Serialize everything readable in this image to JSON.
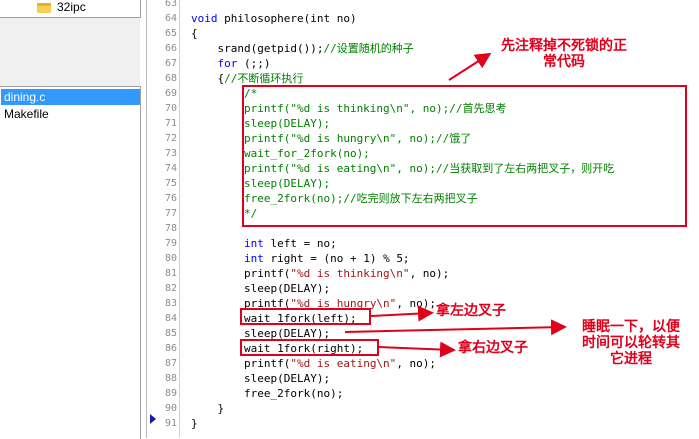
{
  "folder_panel": {
    "folder_label": "32ipc"
  },
  "file_list": {
    "items": [
      "dining.c",
      "Makefile"
    ]
  },
  "editor": {
    "lines": [
      {
        "n": "63",
        "segs": []
      },
      {
        "n": "64",
        "segs": [
          [
            "kw",
            "void"
          ],
          [
            "",
            "philosophere(int no)"
          ]
        ]
      },
      {
        "n": "65",
        "segs": [
          [
            "",
            "{"
          ]
        ]
      },
      {
        "n": "66",
        "segs": [
          [
            "",
            "    srand(getpid());"
          ],
          [
            "cmt",
            "//设置随机的种子"
          ]
        ]
      },
      {
        "n": "67",
        "segs": [
          [
            "",
            "    "
          ],
          [
            "kw",
            "for"
          ],
          [
            "",
            "(;;)"
          ]
        ]
      },
      {
        "n": "68",
        "segs": [
          [
            "",
            "    {"
          ],
          [
            "cmt",
            "//不断循环执行"
          ]
        ]
      },
      {
        "n": "69",
        "segs": [
          [
            "cmt",
            "        /*"
          ]
        ]
      },
      {
        "n": "70",
        "segs": [
          [
            "cmt",
            "        printf(\"%d is thinking\\n\", no);//首先思考"
          ]
        ]
      },
      {
        "n": "71",
        "segs": [
          [
            "cmt",
            "        sleep(DELAY);"
          ]
        ]
      },
      {
        "n": "72",
        "segs": [
          [
            "cmt",
            "        printf(\"%d is hungry\\n\", no);//饿了"
          ]
        ]
      },
      {
        "n": "73",
        "segs": [
          [
            "cmt",
            "        wait_for_2fork(no);"
          ]
        ]
      },
      {
        "n": "74",
        "segs": [
          [
            "cmt",
            "        printf(\"%d is eating\\n\", no);//当获取到了左右两把叉子，则开吃"
          ]
        ]
      },
      {
        "n": "75",
        "segs": [
          [
            "cmt",
            "        sleep(DELAY);"
          ]
        ]
      },
      {
        "n": "76",
        "segs": [
          [
            "cmt",
            "        free_2fork(no);//吃完则放下左右两把叉子"
          ]
        ]
      },
      {
        "n": "77",
        "segs": [
          [
            "cmt",
            "        */"
          ]
        ]
      },
      {
        "n": "78",
        "segs": []
      },
      {
        "n": "79",
        "segs": [
          [
            "",
            "        "
          ],
          [
            "kw",
            "int"
          ],
          [
            "",
            "left = no;"
          ]
        ]
      },
      {
        "n": "80",
        "segs": [
          [
            "",
            "        "
          ],
          [
            "kw",
            "int"
          ],
          [
            "",
            "right = (no + 1) % 5;"
          ]
        ]
      },
      {
        "n": "81",
        "segs": [
          [
            "",
            "        printf("
          ],
          [
            "str",
            "\"%d is thinking\\n\""
          ],
          [
            "",
            ", no);"
          ]
        ]
      },
      {
        "n": "82",
        "segs": [
          [
            "",
            "        sleep(DELAY);"
          ]
        ]
      },
      {
        "n": "83",
        "segs": [
          [
            "",
            "        printf("
          ],
          [
            "str",
            "\"%d is hungry\\n\""
          ],
          [
            "",
            ", no);"
          ]
        ]
      },
      {
        "n": "84",
        "segs": [
          [
            "",
            "        wait_1fork(left);"
          ]
        ]
      },
      {
        "n": "85",
        "segs": [
          [
            "",
            "        sleep(DELAY);"
          ]
        ]
      },
      {
        "n": "86",
        "segs": [
          [
            "",
            "        wait_1fork(right);"
          ]
        ]
      },
      {
        "n": "87",
        "segs": [
          [
            "",
            "        printf("
          ],
          [
            "str",
            "\"%d is eating\\n\""
          ],
          [
            "",
            ", no);"
          ]
        ]
      },
      {
        "n": "88",
        "segs": [
          [
            "",
            "        sleep(DELAY);"
          ]
        ]
      },
      {
        "n": "89",
        "segs": [
          [
            "",
            "        free_2fork(no);"
          ]
        ]
      },
      {
        "n": "90",
        "segs": [
          [
            "",
            "    }"
          ]
        ]
      },
      {
        "n": "91",
        "segs": [
          [
            "",
            "}"
          ]
        ]
      }
    ]
  },
  "annotations": {
    "note_comment_out": "先注释掉不死锁的正\n常代码",
    "note_take_left": "拿左边叉子",
    "note_take_right": "拿右边叉子",
    "note_sleep": "睡眠一下，以便\n时间可以轮转其\n它进程"
  },
  "colors": {
    "annotation_red": "#e0001b",
    "keyword_blue": "#0000ff",
    "comment_green": "#008000",
    "string_red": "#a31515",
    "selection_blue": "#3399ff"
  }
}
